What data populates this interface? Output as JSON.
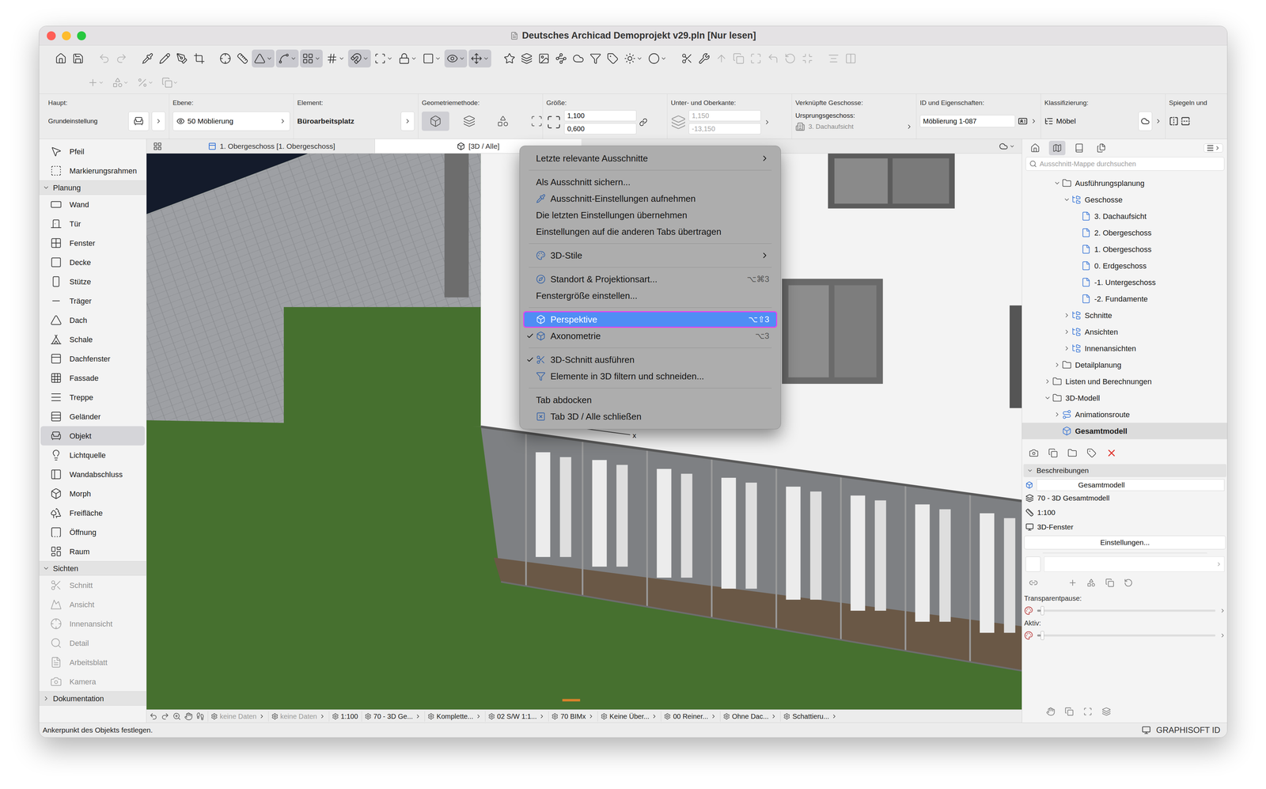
{
  "window": {
    "title": "Deutsches Archicad Demoprojekt v29.pln [Nur lesen]"
  },
  "toolbar": {
    "buttons": [
      {
        "selected": false,
        "menu": false,
        "disabled": false,
        "gap": false
      },
      {
        "selected": false,
        "menu": false,
        "disabled": false,
        "gap": false
      },
      {
        "selected": false,
        "menu": false,
        "disabled": true,
        "gap": true
      },
      {
        "selected": false,
        "menu": false,
        "disabled": true,
        "gap": false
      },
      {
        "selected": false,
        "menu": false,
        "disabled": false,
        "gap": true
      },
      {
        "selected": false,
        "menu": false,
        "disabled": false,
        "gap": false
      },
      {
        "selected": false,
        "menu": false,
        "disabled": false,
        "gap": false
      },
      {
        "selected": false,
        "menu": false,
        "disabled": false,
        "gap": false
      },
      {
        "selected": false,
        "menu": false,
        "disabled": false,
        "gap": true
      },
      {
        "selected": false,
        "menu": false,
        "disabled": false,
        "gap": false
      },
      {
        "selected": true,
        "menu": true,
        "disabled": false,
        "gap": false
      },
      {
        "selected": true,
        "menu": true,
        "disabled": false,
        "gap": false
      },
      {
        "selected": true,
        "menu": true,
        "disabled": false,
        "gap": false
      },
      {
        "selected": false,
        "menu": true,
        "disabled": false,
        "gap": false
      },
      {
        "selected": true,
        "menu": true,
        "disabled": false,
        "gap": false
      },
      {
        "selected": false,
        "menu": true,
        "disabled": false,
        "gap": false
      },
      {
        "selected": false,
        "menu": true,
        "disabled": false,
        "gap": false
      },
      {
        "selected": false,
        "menu": true,
        "disabled": false,
        "gap": false
      },
      {
        "selected": true,
        "menu": true,
        "disabled": false,
        "gap": false
      },
      {
        "selected": true,
        "menu": true,
        "disabled": false,
        "gap": false
      },
      {
        "selected": false,
        "menu": false,
        "disabled": false,
        "gap": true
      },
      {
        "selected": false,
        "menu": false,
        "disabled": false,
        "gap": false
      },
      {
        "selected": false,
        "menu": false,
        "disabled": false,
        "gap": false
      },
      {
        "selected": false,
        "menu": false,
        "disabled": false,
        "gap": false
      },
      {
        "selected": false,
        "menu": false,
        "disabled": false,
        "gap": false
      },
      {
        "selected": false,
        "menu": false,
        "disabled": false,
        "gap": false
      },
      {
        "selected": false,
        "menu": false,
        "disabled": false,
        "gap": false
      },
      {
        "selected": false,
        "menu": true,
        "disabled": false,
        "gap": false
      },
      {
        "selected": false,
        "menu": true,
        "disabled": false,
        "gap": false
      },
      {
        "selected": false,
        "menu": false,
        "disabled": false,
        "gap": true
      },
      {
        "selected": false,
        "menu": false,
        "disabled": false,
        "gap": false
      },
      {
        "selected": false,
        "menu": false,
        "disabled": true,
        "gap": false
      },
      {
        "selected": false,
        "menu": false,
        "disabled": true,
        "gap": false
      },
      {
        "selected": false,
        "menu": false,
        "disabled": true,
        "gap": false
      },
      {
        "selected": false,
        "menu": false,
        "disabled": true,
        "gap": false
      },
      {
        "selected": false,
        "menu": false,
        "disabled": true,
        "gap": false
      },
      {
        "selected": false,
        "menu": false,
        "disabled": true,
        "gap": false
      },
      {
        "selected": false,
        "menu": false,
        "disabled": true,
        "gap": true
      },
      {
        "selected": false,
        "menu": false,
        "disabled": true,
        "gap": false
      }
    ]
  },
  "info_box": {
    "groups": [
      {
        "label": "Haupt:",
        "kind": "main",
        "value": "Grundeinstellung"
      },
      {
        "label": "Ebene:",
        "kind": "layer",
        "value": "50 Möblierung"
      },
      {
        "label": "Element:",
        "kind": "element",
        "value": "Büroarbeitsplatz"
      },
      {
        "label": "Geometriemethode:",
        "kind": "geometry"
      },
      {
        "label": "Größe:",
        "kind": "size",
        "values": [
          "1,100",
          "0,600"
        ]
      },
      {
        "label": "Unter- und Oberkante:",
        "kind": "elevation",
        "values": [
          "1,150",
          "-13,150"
        ],
        "disabled": true
      },
      {
        "label": "Verknüpfte Geschosse:",
        "kind": "story",
        "caption": "Ursprungsgeschoss:",
        "value": "3. Dachaufsicht",
        "disabled": true
      },
      {
        "label": "ID und Eigenschaften:",
        "kind": "id",
        "value": "Möblierung 1-087"
      },
      {
        "label": "Klassifizierung:",
        "kind": "class",
        "value": "Möbel"
      },
      {
        "label": "Spiegeln und",
        "kind": "mirror"
      }
    ]
  },
  "toolbox": {
    "items": [
      {
        "label": "Pfeil",
        "kind": "tool",
        "selected": false,
        "disabled": false
      },
      {
        "label": "Markierungsrahmen",
        "kind": "tool",
        "selected": false,
        "disabled": false
      },
      {
        "label": "Planung",
        "kind": "header",
        "expanded": true
      },
      {
        "label": "Wand",
        "kind": "tool",
        "selected": false,
        "disabled": false
      },
      {
        "label": "Tür",
        "kind": "tool",
        "selected": false,
        "disabled": false
      },
      {
        "label": "Fenster",
        "kind": "tool",
        "selected": false,
        "disabled": false
      },
      {
        "label": "Decke",
        "kind": "tool",
        "selected": false,
        "disabled": false
      },
      {
        "label": "Stütze",
        "kind": "tool",
        "selected": false,
        "disabled": false
      },
      {
        "label": "Träger",
        "kind": "tool",
        "selected": false,
        "disabled": false
      },
      {
        "label": "Dach",
        "kind": "tool",
        "selected": false,
        "disabled": false
      },
      {
        "label": "Schale",
        "kind": "tool",
        "selected": false,
        "disabled": false
      },
      {
        "label": "Dachfenster",
        "kind": "tool",
        "selected": false,
        "disabled": false
      },
      {
        "label": "Fassade",
        "kind": "tool",
        "selected": false,
        "disabled": false
      },
      {
        "label": "Treppe",
        "kind": "tool",
        "selected": false,
        "disabled": false
      },
      {
        "label": "Geländer",
        "kind": "tool",
        "selected": false,
        "disabled": false
      },
      {
        "label": "Objekt",
        "kind": "tool",
        "selected": true,
        "disabled": false
      },
      {
        "label": "Lichtquelle",
        "kind": "tool",
        "selected": false,
        "disabled": false
      },
      {
        "label": "Wandabschluss",
        "kind": "tool",
        "selected": false,
        "disabled": false
      },
      {
        "label": "Morph",
        "kind": "tool",
        "selected": false,
        "disabled": false
      },
      {
        "label": "Freifläche",
        "kind": "tool",
        "selected": false,
        "disabled": false
      },
      {
        "label": "Öffnung",
        "kind": "tool",
        "selected": false,
        "disabled": false
      },
      {
        "label": "Raum",
        "kind": "tool",
        "selected": false,
        "disabled": false
      },
      {
        "label": "Sichten",
        "kind": "header",
        "expanded": true
      },
      {
        "label": "Schnitt",
        "kind": "tool",
        "selected": false,
        "disabled": true
      },
      {
        "label": "Ansicht",
        "kind": "tool",
        "selected": false,
        "disabled": true
      },
      {
        "label": "Innenansicht",
        "kind": "tool",
        "selected": false,
        "disabled": true
      },
      {
        "label": "Detail",
        "kind": "tool",
        "selected": false,
        "disabled": true
      },
      {
        "label": "Arbeitsblatt",
        "kind": "tool",
        "selected": false,
        "disabled": true
      },
      {
        "label": "Kamera",
        "kind": "tool",
        "selected": false,
        "disabled": true
      },
      {
        "label": "Dokumentation",
        "kind": "header",
        "expanded": false
      }
    ]
  },
  "tabs": [
    {
      "label": "1. Obergeschoss [1. Obergeschoss]",
      "selected": false
    },
    {
      "label": "[3D / Alle]",
      "selected": true
    }
  ],
  "context_menu": {
    "items": [
      {
        "kind": "item",
        "label": "Letzte relevante Ausschnitte",
        "shortcut": "",
        "submenu": true,
        "checked": false,
        "highlighted": false,
        "has_icon": false
      },
      {
        "kind": "separator"
      },
      {
        "kind": "item",
        "label": "Als Ausschnitt sichern...",
        "shortcut": "",
        "submenu": false,
        "checked": false,
        "highlighted": false,
        "has_icon": false
      },
      {
        "kind": "item",
        "label": "Ausschnitt-Einstellungen aufnehmen",
        "shortcut": "",
        "submenu": false,
        "checked": false,
        "highlighted": false,
        "has_icon": true
      },
      {
        "kind": "item",
        "label": "Die letzten Einstellungen übernehmen",
        "shortcut": "",
        "submenu": false,
        "checked": false,
        "highlighted": false,
        "has_icon": false
      },
      {
        "kind": "item",
        "label": "Einstellungen auf die anderen Tabs übertragen",
        "shortcut": "",
        "submenu": false,
        "checked": false,
        "highlighted": false,
        "has_icon": false
      },
      {
        "kind": "separator"
      },
      {
        "kind": "item",
        "label": "3D-Stile",
        "shortcut": "",
        "submenu": true,
        "checked": false,
        "highlighted": false,
        "has_icon": true
      },
      {
        "kind": "separator"
      },
      {
        "kind": "item",
        "label": "Standort & Projektionsart...",
        "shortcut": "⌥⌘3",
        "submenu": false,
        "checked": false,
        "highlighted": false,
        "has_icon": true
      },
      {
        "kind": "item",
        "label": "Fenstergröße einstellen...",
        "shortcut": "",
        "submenu": false,
        "checked": false,
        "highlighted": false,
        "has_icon": false
      },
      {
        "kind": "separator"
      },
      {
        "kind": "item",
        "label": "Perspektive",
        "shortcut": "⌥⇧3",
        "submenu": false,
        "checked": false,
        "highlighted": true,
        "has_icon": true
      },
      {
        "kind": "item",
        "label": "Axonometrie",
        "shortcut": "⌥3",
        "submenu": false,
        "checked": true,
        "highlighted": false,
        "has_icon": true
      },
      {
        "kind": "separator"
      },
      {
        "kind": "item",
        "label": "3D-Schnitt ausführen",
        "shortcut": "",
        "submenu": false,
        "checked": true,
        "highlighted": false,
        "has_icon": true
      },
      {
        "kind": "item",
        "label": "Elemente in 3D filtern und schneiden...",
        "shortcut": "",
        "submenu": false,
        "checked": false,
        "highlighted": false,
        "has_icon": true
      },
      {
        "kind": "separator"
      },
      {
        "kind": "item",
        "label": "Tab abdocken",
        "shortcut": "",
        "submenu": false,
        "checked": false,
        "highlighted": false,
        "has_icon": false
      },
      {
        "kind": "item",
        "label": "Tab 3D / Alle schließen",
        "shortcut": "",
        "submenu": false,
        "checked": false,
        "highlighted": false,
        "has_icon": true
      }
    ]
  },
  "canvas": {
    "axis_label": "x"
  },
  "navigator": {
    "search_placeholder": "Ausschnitt-Mappe durchsuchen",
    "tree": [
      {
        "label": "Ausführungsplanung",
        "depth": 1,
        "expandable": true,
        "expanded": true,
        "selected": false,
        "kind": "folder"
      },
      {
        "label": "Geschosse",
        "depth": 2,
        "expandable": true,
        "expanded": true,
        "selected": false,
        "kind": "group"
      },
      {
        "label": "3. Dachaufsicht",
        "depth": 3,
        "expandable": false,
        "expanded": false,
        "selected": false,
        "kind": "story"
      },
      {
        "label": "2. Obergeschoss",
        "depth": 3,
        "expandable": false,
        "expanded": false,
        "selected": false,
        "kind": "story"
      },
      {
        "label": "1. Obergeschoss",
        "depth": 3,
        "expandable": false,
        "expanded": false,
        "selected": false,
        "kind": "story"
      },
      {
        "label": "0. Erdgeschoss",
        "depth": 3,
        "expandable": false,
        "expanded": false,
        "selected": false,
        "kind": "story"
      },
      {
        "label": "-1. Untergeschoss",
        "depth": 3,
        "expandable": false,
        "expanded": false,
        "selected": false,
        "kind": "story"
      },
      {
        "label": "-2. Fundamente",
        "depth": 3,
        "expandable": false,
        "expanded": false,
        "selected": false,
        "kind": "story"
      },
      {
        "label": "Schnitte",
        "depth": 2,
        "expandable": true,
        "expanded": false,
        "selected": false,
        "kind": "group"
      },
      {
        "label": "Ansichten",
        "depth": 2,
        "expandable": true,
        "expanded": false,
        "selected": false,
        "kind": "group"
      },
      {
        "label": "Innenansichten",
        "depth": 2,
        "expandable": true,
        "expanded": false,
        "selected": false,
        "kind": "group"
      },
      {
        "label": "Detailplanung",
        "depth": 1,
        "expandable": true,
        "expanded": false,
        "selected": false,
        "kind": "folder"
      },
      {
        "label": "Listen und Berechnungen",
        "depth": 0,
        "expandable": true,
        "expanded": false,
        "selected": false,
        "kind": "folder"
      },
      {
        "label": "3D-Modell",
        "depth": 0,
        "expandable": true,
        "expanded": true,
        "selected": false,
        "kind": "folder"
      },
      {
        "label": "Animationsroute",
        "depth": 1,
        "expandable": true,
        "expanded": false,
        "selected": false,
        "kind": "route"
      },
      {
        "label": "Gesamtmodell",
        "depth": 1,
        "expandable": false,
        "expanded": false,
        "selected": true,
        "kind": "model"
      }
    ],
    "properties": {
      "header": "Beschreibungen",
      "expanded": true,
      "name": "Gesamtmodell",
      "rows": [
        "70 - 3D Gesamtmodell",
        "1:100",
        "3D-Fenster"
      ],
      "button": "Einstellungen...",
      "sliders": [
        {
          "label": "Transparentpause:",
          "level": 0.02
        },
        {
          "label": "Aktiv:",
          "level": 0.02
        }
      ]
    }
  },
  "status_bar": {
    "items": [
      {
        "label": "keine Daten",
        "chevron": true,
        "disabled": true
      },
      {
        "label": "keine Daten",
        "chevron": true,
        "disabled": true
      },
      {
        "label": "1:100",
        "chevron": false,
        "disabled": false
      },
      {
        "label": "70 - 3D Ge...",
        "chevron": true,
        "disabled": false
      },
      {
        "label": "Komplette...",
        "chevron": true,
        "disabled": false
      },
      {
        "label": "02 S/W 1:1...",
        "chevron": true,
        "disabled": false
      },
      {
        "label": "70 BIMx",
        "chevron": true,
        "disabled": false
      },
      {
        "label": "Keine Über...",
        "chevron": true,
        "disabled": false
      },
      {
        "label": "00 Reiner...",
        "chevron": true,
        "disabled": false
      },
      {
        "label": "Ohne Dac...",
        "chevron": true,
        "disabled": false
      },
      {
        "label": "Schattieru...",
        "chevron": true,
        "disabled": false
      }
    ]
  },
  "message_bar": {
    "message": "Ankerpunkt des Objekts festlegen.",
    "brand": "GRAPHISOFT ID"
  }
}
